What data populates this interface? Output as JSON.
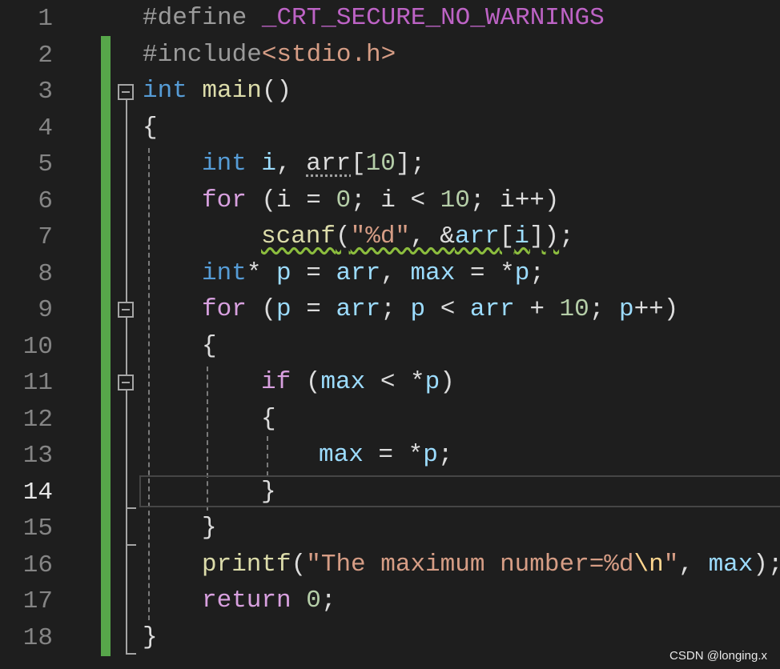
{
  "line_numbers": [
    "1",
    "2",
    "3",
    "4",
    "5",
    "6",
    "7",
    "8",
    "9",
    "10",
    "11",
    "12",
    "13",
    "14",
    "15",
    "16",
    "17",
    "18"
  ],
  "current_line": "14",
  "code": {
    "l1_directive": "#define",
    "l1_macro": "_CRT_SECURE_NO_WARNINGS",
    "l2_directive": "#include",
    "l2_header": "<stdio.h>",
    "l3_type": "int",
    "l3_name": "main",
    "l3_parens": "()",
    "l4_brace": "{",
    "l5_type": "int",
    "l5_i": "i",
    "l5_comma": ", ",
    "l5_arr": "arr",
    "l5_bracket_open": "[",
    "l5_size": "10",
    "l5_rest": "];",
    "l6_for": "for",
    "l6_a": " (i = ",
    "l6_zero": "0",
    "l6_b": "; i < ",
    "l6_ten": "10",
    "l6_c": "; i++)",
    "l7_scanf": "scanf",
    "l7_paren": "(",
    "l7_fmt": "\"%d\"",
    "l7_amp": ", &",
    "l7_arr": "arr",
    "l7_idx_open": "[",
    "l7_i": "i",
    "l7_close": "])",
    "l7_semi": ";",
    "l8_type": "int",
    "l8_star": "* ",
    "l8_p": "p",
    "l8_eq": " = ",
    "l8_arr": "arr",
    "l8_comma": ", ",
    "l8_max": "max",
    "l8_deref": " = *",
    "l8_p2": "p",
    "l8_semi": ";",
    "l9_for": "for",
    "l9_a": " (",
    "l9_p": "p",
    "l9_b": " = ",
    "l9_arr": "arr",
    "l9_c": "; ",
    "l9_p2": "p",
    "l9_d": " < ",
    "l9_arr2": "arr",
    "l9_e": " + ",
    "l9_ten": "10",
    "l9_f": "; ",
    "l9_p3": "p",
    "l9_g": "++)",
    "l10_brace": "{",
    "l11_if": "if",
    "l11_a": " (",
    "l11_max": "max",
    "l11_b": " < *",
    "l11_p": "p",
    "l11_c": ")",
    "l12_brace": "{",
    "l13_max": "max",
    "l13_a": " = *",
    "l13_p": "p",
    "l13_semi": ";",
    "l14_brace": "}",
    "l15_brace": "}",
    "l16_printf": "printf",
    "l16_paren": "(",
    "l16_str": "\"The maximum number=%d",
    "l16_esc": "\\n",
    "l16_quote": "\"",
    "l16_comma": ", ",
    "l16_max": "max",
    "l16_close": ");",
    "l17_return": "return",
    "l17_space": " ",
    "l17_zero": "0",
    "l17_semi": ";",
    "l18_brace": "}"
  },
  "watermark": "CSDN @longing.x",
  "colors": {
    "background": "#1e1e1e",
    "keyword": "#569cd6",
    "control": "#d8a0df",
    "string": "#d69d85",
    "number": "#b5cea8",
    "variable": "#9cdcfe",
    "function": "#dcdcaa",
    "change_bar": "#57a64a"
  }
}
